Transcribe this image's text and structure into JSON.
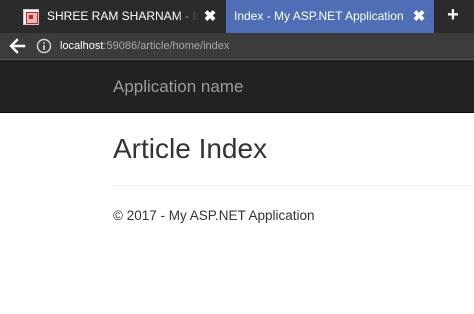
{
  "browser": {
    "tabs": [
      {
        "title": "SHREE RAM SHARNAM - Int",
        "active": false,
        "favicon": "site-favicon-icon",
        "close": "✖"
      },
      {
        "title": "Index - My ASP.NET Application",
        "active": true,
        "close": "✖"
      }
    ],
    "new_tab_label": "+",
    "address": {
      "host": "localhost",
      "rest": ":59086/article/home/index"
    },
    "icons": {
      "back": "back-arrow-icon",
      "info": "info-icon"
    },
    "colors": {
      "tab_active": "#4e6eb6",
      "tab_strip": "#2b2b2b",
      "toolbar": "#3c3c3c"
    }
  },
  "page": {
    "navbar": {
      "brand": "Application name",
      "background": "#222222",
      "brand_color": "#9d9d9d"
    },
    "main": {
      "title": "Article Index"
    },
    "footer": {
      "text": "© 2017 - My ASP.NET Application"
    }
  }
}
